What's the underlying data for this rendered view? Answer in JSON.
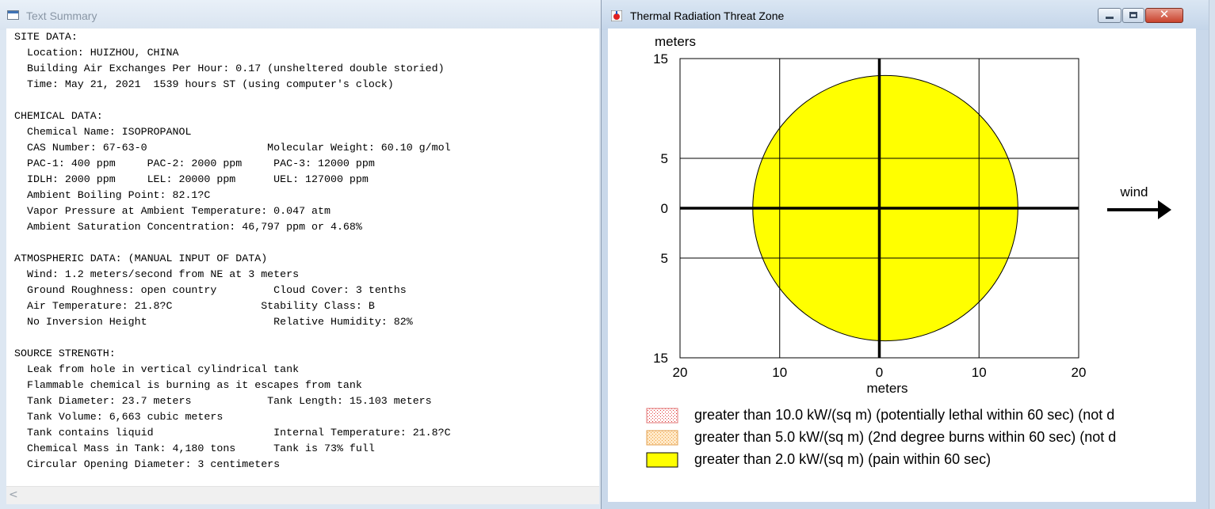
{
  "text_summary": {
    "title": "Text Summary",
    "lines": [
      "SITE DATA:",
      "  Location: HUIZHOU, CHINA",
      "  Building Air Exchanges Per Hour: 0.17 (unsheltered double storied)",
      "  Time: May 21, 2021  1539 hours ST (using computer's clock)",
      "",
      "CHEMICAL DATA:",
      "  Chemical Name: ISOPROPANOL",
      "  CAS Number: 67-63-0                   Molecular Weight: 60.10 g/mol",
      "  PAC-1: 400 ppm     PAC-2: 2000 ppm     PAC-3: 12000 ppm",
      "  IDLH: 2000 ppm     LEL: 20000 ppm      UEL: 127000 ppm",
      "  Ambient Boiling Point: 82.1?C",
      "  Vapor Pressure at Ambient Temperature: 0.047 atm",
      "  Ambient Saturation Concentration: 46,797 ppm or 4.68%",
      "",
      "ATMOSPHERIC DATA: (MANUAL INPUT OF DATA)",
      "  Wind: 1.2 meters/second from NE at 3 meters",
      "  Ground Roughness: open country         Cloud Cover: 3 tenths",
      "  Air Temperature: 21.8?C              Stability Class: B",
      "  No Inversion Height                    Relative Humidity: 82%",
      "",
      "SOURCE STRENGTH:",
      "  Leak from hole in vertical cylindrical tank",
      "  Flammable chemical is burning as it escapes from tank",
      "  Tank Diameter: 23.7 meters            Tank Length: 15.103 meters",
      "  Tank Volume: 6,663 cubic meters",
      "  Tank contains liquid                   Internal Temperature: 21.8?C",
      "  Chemical Mass in Tank: 4,180 tons      Tank is 73% full",
      "  Circular Opening Diameter: 3 centimeters"
    ],
    "scroll_left_glyph": "<"
  },
  "threat_zone": {
    "title": "Thermal Radiation Threat Zone",
    "close_glyph": "✕",
    "y_unit": "meters",
    "x_unit": "meters",
    "y_tick_labels": [
      "15",
      "5",
      "0",
      "5",
      "15"
    ],
    "x_tick_labels": [
      "20",
      "10",
      "0",
      "10",
      "20"
    ],
    "wind_label": "wind",
    "zone_color": "#ffff00",
    "legend": [
      {
        "text": "greater than 10.0 kW/(sq m) (potentially lethal within 60 sec) (not d",
        "pattern": "red-dots"
      },
      {
        "text": "greater than 5.0 kW/(sq m) (2nd degree burns within 60 sec) (not d",
        "pattern": "orange-dots"
      },
      {
        "text": "greater than 2.0 kW/(sq m) (pain within 60 sec)",
        "pattern": "yellow-solid"
      }
    ]
  },
  "chart_data": {
    "type": "area",
    "title": "Thermal Radiation Threat Zone",
    "xlabel": "meters",
    "ylabel": "meters",
    "xlim": [
      -20,
      20
    ],
    "ylim": [
      -15,
      15
    ],
    "x_gridlines": [
      -10,
      0,
      10
    ],
    "y_gridlines": [
      -5,
      0,
      5
    ],
    "grid": true,
    "zones": [
      {
        "name": "greater than 2.0 kW/(sq m) (pain within 60 sec)",
        "shape": "circle",
        "center_x": 0.6,
        "center_y": 0,
        "radius_x": 13.3,
        "radius_y": 13.3,
        "color": "#ffff00"
      }
    ],
    "wind_direction": "right"
  }
}
